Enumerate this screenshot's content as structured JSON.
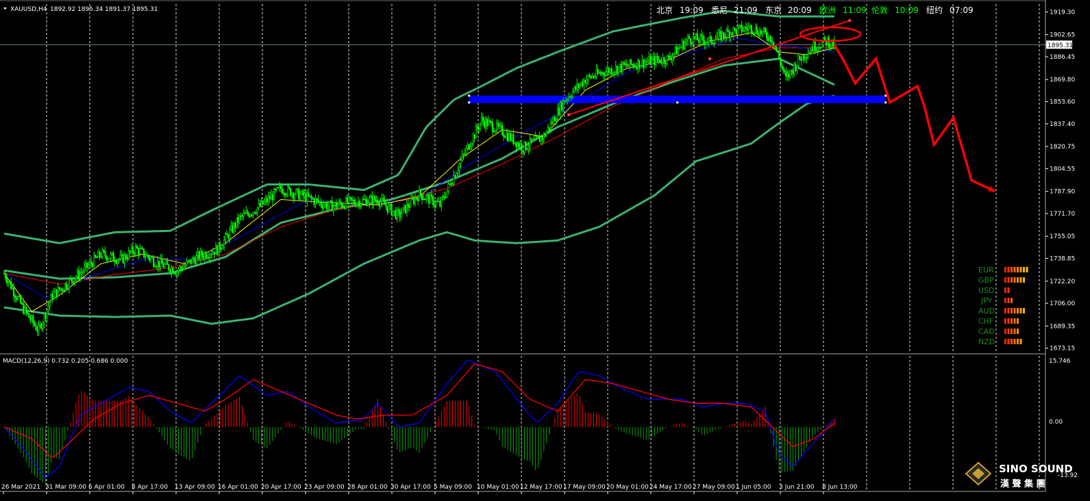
{
  "colors": {
    "background": "#000000",
    "grid": "#ffffff",
    "candle": "#00ff00",
    "bollinger": "#3cb371",
    "ma_fast": "#ffff00",
    "ma_mid": "#0000ff",
    "ma_slow": "#ff0000",
    "resistance": "#0000ff",
    "projection": "#ff0000",
    "macd_line": "#0000ff",
    "signal_line": "#ff0000",
    "hist_pos": "#ff0000",
    "hist_neg": "#00aa00",
    "clock_active": "#00ff00",
    "clock_idle": "#ffffff"
  },
  "header": {
    "symbol_text": "XAUUSD,H4",
    "ohlc_text": "1892.92 1895.34 1891.37 1895.31"
  },
  "clocks": [
    {
      "city": "北京",
      "time": "19:09",
      "active": false
    },
    {
      "city": "悉尼",
      "time": "21:09",
      "active": false
    },
    {
      "city": "东京",
      "time": "20:09",
      "active": false
    },
    {
      "city": "欧洲",
      "time": "11:09",
      "active": true
    },
    {
      "city": "伦敦",
      "time": "10:09",
      "active": true
    },
    {
      "city": "纽约",
      "time": "07:09",
      "active": false
    }
  ],
  "strength": [
    {
      "ccy": "EUR",
      "level": 8
    },
    {
      "ccy": "GBP",
      "level": 7
    },
    {
      "ccy": "USD",
      "level": 2
    },
    {
      "ccy": "JPY",
      "level": 3
    },
    {
      "ccy": "AUD",
      "level": 7
    },
    {
      "ccy": "CHF",
      "level": 5
    },
    {
      "ccy": "CAD",
      "level": 5
    },
    {
      "ccy": "NZD",
      "level": 6
    }
  ],
  "macd": {
    "label": "MACD(12,26,9) 0.732 0.205 0.686 0.000",
    "top_label": "15.746",
    "zero_label": "0.00",
    "bottom_label": "-13.92"
  },
  "watermark": {
    "brand": "SINO SOUND",
    "chinese": "漢 聲 集 團"
  },
  "chart_data": {
    "type": "candlestick",
    "symbol": "XAUUSD",
    "timeframe": "H4",
    "ylim": [
      1670.0,
      1925.0
    ],
    "y_ticks": [
      {
        "v": 1919.3,
        "label": "1919.30"
      },
      {
        "v": 1902.65,
        "label": "1902.65"
      },
      {
        "v": 1886.45,
        "label": "1886.45"
      },
      {
        "v": 1869.8,
        "label": "1869.80"
      },
      {
        "v": 1853.6,
        "label": "1853.60"
      },
      {
        "v": 1837.4,
        "label": "1837.40"
      },
      {
        "v": 1820.75,
        "label": "1820.75"
      },
      {
        "v": 1804.55,
        "label": "1804.55"
      },
      {
        "v": 1787.9,
        "label": "1787.90"
      },
      {
        "v": 1771.7,
        "label": "1771.70"
      },
      {
        "v": 1755.05,
        "label": "1755.05"
      },
      {
        "v": 1738.85,
        "label": "1738.85"
      },
      {
        "v": 1722.2,
        "label": "1722.20"
      },
      {
        "v": 1706.0,
        "label": "1706.00"
      },
      {
        "v": 1689.35,
        "label": "1689.35"
      },
      {
        "v": 1673.15,
        "label": "1673.15"
      }
    ],
    "current_price": {
      "v": 1895.31,
      "label": "1895.31"
    },
    "x_ticks": [
      "26 Mar 2021",
      "31 Mar 09:00",
      "6 Apr 01:00",
      "8 Apr 17:00",
      "13 Apr 09:00",
      "16 Apr 01:00",
      "20 Apr 17:00",
      "23 Apr 09:00",
      "28 Apr 01:00",
      "30 Apr 17:00",
      "5 May 09:00",
      "10 May 01:00",
      "12 May 17:00",
      "17 May 09:00",
      "20 May 01:00",
      "24 May 17:00",
      "27 May 09:00",
      "1 Jun 05:00",
      "3 Jun 21:00",
      "8 Jun 13:00"
    ],
    "n_bars": 400,
    "price_path": [
      [
        0,
        1728
      ],
      [
        15,
        1700
      ],
      [
        25,
        1686
      ],
      [
        35,
        1712
      ],
      [
        55,
        1728
      ],
      [
        70,
        1742
      ],
      [
        85,
        1738
      ],
      [
        95,
        1746
      ],
      [
        110,
        1736
      ],
      [
        125,
        1730
      ],
      [
        140,
        1740
      ],
      [
        155,
        1746
      ],
      [
        170,
        1768
      ],
      [
        185,
        1777
      ],
      [
        200,
        1790
      ],
      [
        215,
        1785
      ],
      [
        235,
        1777
      ],
      [
        250,
        1780
      ],
      [
        270,
        1782
      ],
      [
        285,
        1770
      ],
      [
        300,
        1786
      ],
      [
        315,
        1778
      ],
      [
        330,
        1810
      ],
      [
        345,
        1840
      ],
      [
        360,
        1832
      ],
      [
        375,
        1820
      ],
      [
        390,
        1828
      ],
      [
        405,
        1855
      ],
      [
        420,
        1870
      ],
      [
        435,
        1876
      ],
      [
        450,
        1880
      ],
      [
        465,
        1883
      ],
      [
        480,
        1885
      ],
      [
        495,
        1900
      ],
      [
        510,
        1898
      ],
      [
        525,
        1905
      ],
      [
        540,
        1908
      ],
      [
        555,
        1900
      ],
      [
        560,
        1885
      ],
      [
        565,
        1870
      ],
      [
        575,
        1885
      ],
      [
        585,
        1894
      ],
      [
        595,
        1898
      ],
      [
        600,
        1895
      ]
    ],
    "bollinger": {
      "upper": [
        [
          0,
          1757
        ],
        [
          40,
          1750
        ],
        [
          80,
          1758
        ],
        [
          120,
          1759
        ],
        [
          150,
          1774
        ],
        [
          190,
          1793
        ],
        [
          220,
          1793
        ],
        [
          260,
          1789
        ],
        [
          285,
          1800
        ],
        [
          305,
          1835
        ],
        [
          325,
          1855
        ],
        [
          345,
          1865
        ],
        [
          370,
          1878
        ],
        [
          400,
          1890
        ],
        [
          440,
          1905
        ],
        [
          490,
          1915
        ],
        [
          520,
          1920
        ],
        [
          560,
          1916
        ],
        [
          600,
          1916
        ]
      ],
      "middle": [
        [
          0,
          1730
        ],
        [
          40,
          1724
        ],
        [
          80,
          1725
        ],
        [
          120,
          1728
        ],
        [
          160,
          1740
        ],
        [
          200,
          1765
        ],
        [
          240,
          1775
        ],
        [
          280,
          1782
        ],
        [
          320,
          1795
        ],
        [
          360,
          1812
        ],
        [
          400,
          1835
        ],
        [
          440,
          1852
        ],
        [
          480,
          1867
        ],
        [
          520,
          1880
        ],
        [
          560,
          1885
        ],
        [
          600,
          1866
        ]
      ],
      "lower": [
        [
          0,
          1703
        ],
        [
          40,
          1697
        ],
        [
          80,
          1696
        ],
        [
          120,
          1697
        ],
        [
          150,
          1691
        ],
        [
          180,
          1695
        ],
        [
          220,
          1713
        ],
        [
          260,
          1735
        ],
        [
          300,
          1752
        ],
        [
          320,
          1758
        ],
        [
          340,
          1752
        ],
        [
          370,
          1750
        ],
        [
          400,
          1752
        ],
        [
          430,
          1762
        ],
        [
          470,
          1785
        ],
        [
          500,
          1810
        ],
        [
          540,
          1823
        ],
        [
          560,
          1838
        ],
        [
          580,
          1852
        ],
        [
          600,
          1858
        ]
      ]
    },
    "ma_fast": [
      [
        0,
        1728
      ],
      [
        20,
        1700
      ],
      [
        40,
        1712
      ],
      [
        70,
        1735
      ],
      [
        100,
        1742
      ],
      [
        130,
        1735
      ],
      [
        160,
        1750
      ],
      [
        200,
        1782
      ],
      [
        230,
        1780
      ],
      [
        270,
        1778
      ],
      [
        300,
        1784
      ],
      [
        330,
        1812
      ],
      [
        360,
        1833
      ],
      [
        390,
        1828
      ],
      [
        420,
        1862
      ],
      [
        450,
        1878
      ],
      [
        480,
        1884
      ],
      [
        510,
        1898
      ],
      [
        540,
        1904
      ],
      [
        560,
        1890
      ],
      [
        580,
        1888
      ],
      [
        600,
        1893
      ]
    ],
    "ma_mid": [
      [
        0,
        1728
      ],
      [
        30,
        1710
      ],
      [
        60,
        1725
      ],
      [
        100,
        1738
      ],
      [
        140,
        1738
      ],
      [
        180,
        1760
      ],
      [
        220,
        1782
      ],
      [
        260,
        1779
      ],
      [
        300,
        1782
      ],
      [
        330,
        1804
      ],
      [
        370,
        1828
      ],
      [
        410,
        1850
      ],
      [
        450,
        1875
      ],
      [
        490,
        1888
      ],
      [
        530,
        1900
      ],
      [
        560,
        1895
      ],
      [
        600,
        1890
      ]
    ],
    "ma_slow": [
      [
        0,
        1728
      ],
      [
        40,
        1720
      ],
      [
        80,
        1727
      ],
      [
        120,
        1732
      ],
      [
        160,
        1742
      ],
      [
        200,
        1762
      ],
      [
        240,
        1775
      ],
      [
        280,
        1780
      ],
      [
        320,
        1790
      ],
      [
        360,
        1808
      ],
      [
        400,
        1828
      ],
      [
        440,
        1850
      ],
      [
        480,
        1868
      ],
      [
        520,
        1885
      ],
      [
        560,
        1893
      ],
      [
        600,
        1893
      ]
    ],
    "resistance_zone": {
      "price": 1855,
      "from_bar": 336,
      "to_bar": 637
    },
    "trendline": [
      [
        408,
        1844
      ],
      [
        510,
        1885
      ],
      [
        611,
        1913
      ]
    ],
    "projection": [
      [
        600,
        1895
      ],
      [
        606,
        1885
      ],
      [
        615,
        1867
      ],
      [
        630,
        1885
      ],
      [
        640,
        1853
      ],
      [
        660,
        1865
      ],
      [
        665,
        1850
      ],
      [
        672,
        1822
      ],
      [
        686,
        1842
      ],
      [
        699,
        1796
      ],
      [
        716,
        1788
      ]
    ],
    "macd": {
      "ylim": [
        -16,
        18
      ],
      "macd_line": [
        [
          0,
          0
        ],
        [
          15,
          -6
        ],
        [
          30,
          -13
        ],
        [
          40,
          -10
        ],
        [
          55,
          3
        ],
        [
          70,
          6
        ],
        [
          90,
          10
        ],
        [
          105,
          9
        ],
        [
          120,
          4
        ],
        [
          135,
          1
        ],
        [
          150,
          6
        ],
        [
          170,
          13
        ],
        [
          190,
          8
        ],
        [
          205,
          9
        ],
        [
          225,
          4
        ],
        [
          240,
          1
        ],
        [
          260,
          2
        ],
        [
          270,
          6
        ],
        [
          285,
          0
        ],
        [
          300,
          1
        ],
        [
          320,
          11
        ],
        [
          335,
          17
        ],
        [
          355,
          14
        ],
        [
          375,
          5
        ],
        [
          385,
          1
        ],
        [
          400,
          6
        ],
        [
          415,
          14
        ],
        [
          430,
          13
        ],
        [
          445,
          10
        ],
        [
          465,
          7
        ],
        [
          475,
          7
        ],
        [
          490,
          7
        ],
        [
          505,
          5
        ],
        [
          520,
          6
        ],
        [
          535,
          6
        ],
        [
          550,
          4
        ],
        [
          560,
          -7
        ],
        [
          570,
          -10
        ],
        [
          580,
          -6
        ],
        [
          600,
          2
        ]
      ],
      "signal_line": [
        [
          0,
          0
        ],
        [
          20,
          -3
        ],
        [
          35,
          -8
        ],
        [
          50,
          -3
        ],
        [
          65,
          2
        ],
        [
          85,
          6
        ],
        [
          105,
          8
        ],
        [
          125,
          6
        ],
        [
          145,
          4
        ],
        [
          160,
          7
        ],
        [
          180,
          12
        ],
        [
          200,
          9
        ],
        [
          220,
          6
        ],
        [
          240,
          3
        ],
        [
          255,
          2
        ],
        [
          275,
          3
        ],
        [
          295,
          3
        ],
        [
          320,
          8
        ],
        [
          340,
          16
        ],
        [
          360,
          14
        ],
        [
          380,
          7
        ],
        [
          400,
          4
        ],
        [
          420,
          12
        ],
        [
          440,
          11
        ],
        [
          460,
          9
        ],
        [
          480,
          7
        ],
        [
          500,
          6
        ],
        [
          520,
          6
        ],
        [
          540,
          5
        ],
        [
          555,
          0
        ],
        [
          570,
          -5
        ],
        [
          585,
          -3
        ],
        [
          600,
          1
        ]
      ]
    }
  }
}
